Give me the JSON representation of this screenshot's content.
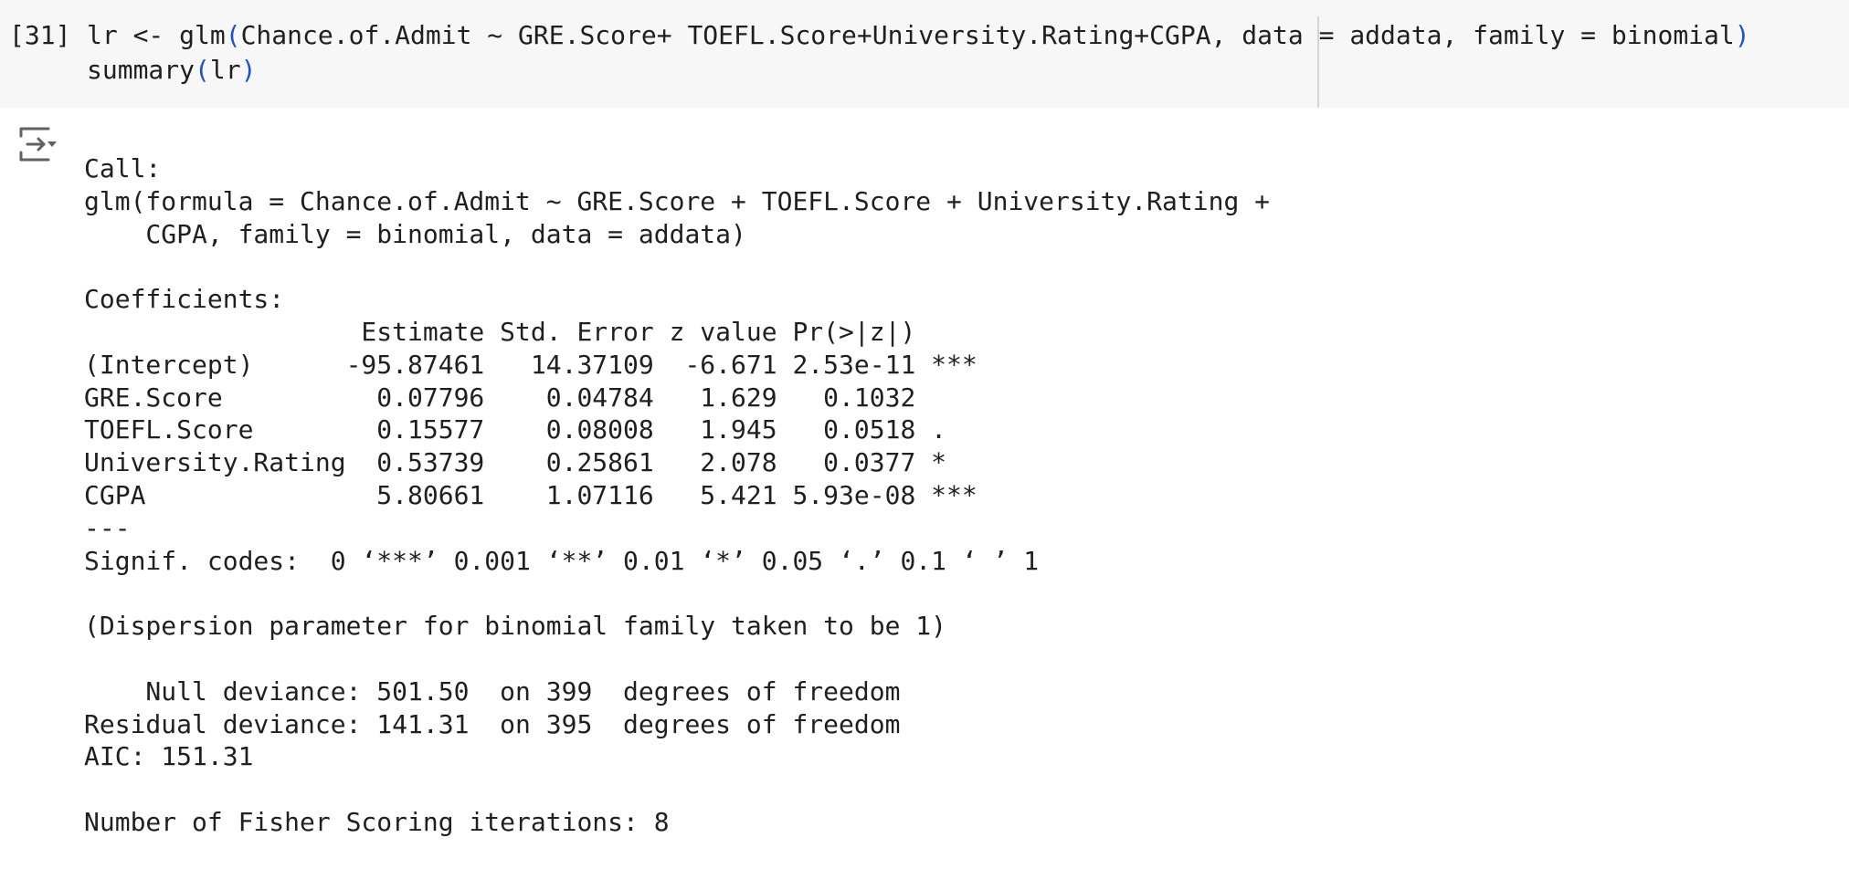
{
  "input_cell": {
    "execution_count": "[31]",
    "line1": {
      "prefix": "lr <- glm",
      "open_paren": "(",
      "args": "Chance.of.Admit ~ GRE.Score+ TOEFL.Score+University.Rating+CGPA, data = addata, family = binomial",
      "close_paren": ")"
    },
    "line2": {
      "prefix": "summary",
      "open_paren": "(",
      "args": "lr",
      "close_paren": ")"
    }
  },
  "output": {
    "toggle_icon": "output-collapse-icon",
    "lines": [
      "Call:",
      "glm(formula = Chance.of.Admit ~ GRE.Score + TOEFL.Score + University.Rating + ",
      "    CGPA, family = binomial, data = addata)",
      "",
      "Coefficients:",
      "                  Estimate Std. Error z value Pr(>|z|)    ",
      "(Intercept)      -95.87461   14.37109  -6.671 2.53e-11 ***",
      "GRE.Score          0.07796    0.04784   1.629   0.1032    ",
      "TOEFL.Score        0.15577    0.08008   1.945   0.0518 .  ",
      "University.Rating  0.53739    0.25861   2.078   0.0377 *  ",
      "CGPA               5.80661    1.07116   5.421 5.93e-08 ***",
      "---",
      "Signif. codes:  0 ‘***’ 0.001 ‘**’ 0.01 ‘*’ 0.05 ‘.’ 0.1 ‘ ’ 1",
      "",
      "(Dispersion parameter for binomial family taken to be 1)",
      "",
      "    Null deviance: 501.50  on 399  degrees of freedom",
      "Residual deviance: 141.31  on 395  degrees of freedom",
      "AIC: 151.31",
      "",
      "Number of Fisher Scoring iterations: 8"
    ]
  }
}
